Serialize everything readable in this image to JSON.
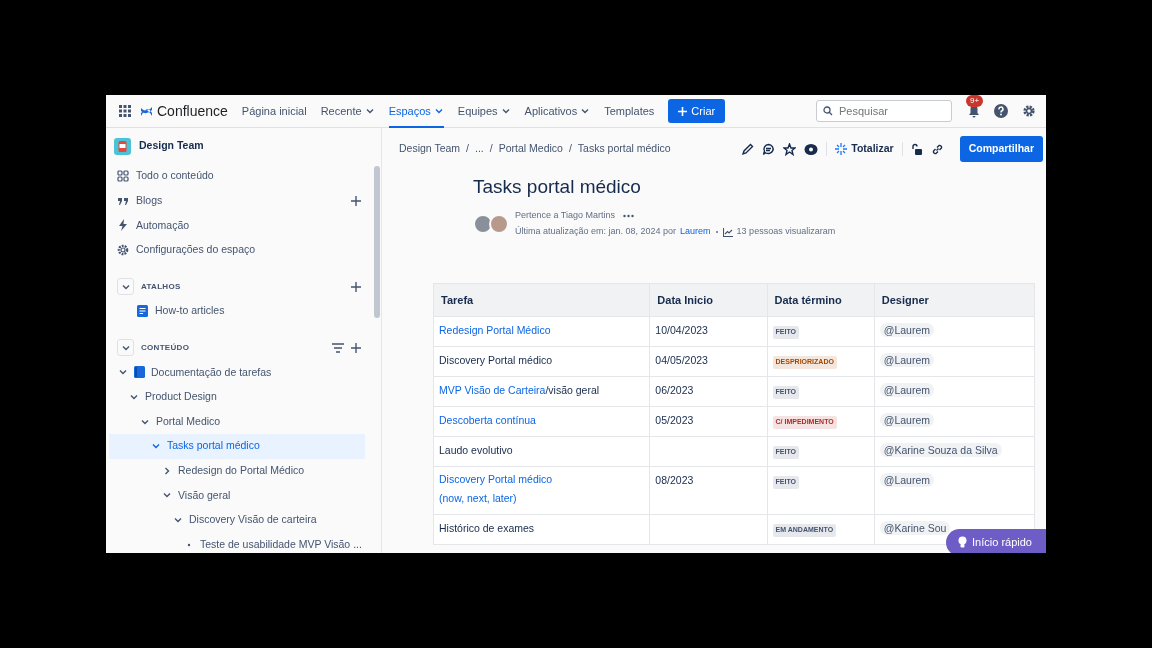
{
  "topnav": {
    "app_name": "Confluence",
    "items": [
      {
        "label": "Página inicial",
        "dropdown": false,
        "selected": false
      },
      {
        "label": "Recente",
        "dropdown": true,
        "selected": false
      },
      {
        "label": "Espaços",
        "dropdown": true,
        "selected": true
      },
      {
        "label": "Equipes",
        "dropdown": true,
        "selected": false
      },
      {
        "label": "Aplicativos",
        "dropdown": true,
        "selected": false
      },
      {
        "label": "Templates",
        "dropdown": false,
        "selected": false
      }
    ],
    "create_button": "Criar",
    "search": {
      "placeholder": "Pesquisar"
    },
    "notification_badge": "9+"
  },
  "sidebar": {
    "space_name": "Design Team",
    "links": [
      {
        "kind": "grid",
        "label": "Todo o conteúdo",
        "addable": false
      },
      {
        "kind": "quote",
        "label": "Blogs",
        "addable": true
      },
      {
        "kind": "bolt",
        "label": "Automação",
        "addable": false
      },
      {
        "kind": "gear",
        "label": "Configurações do espaço",
        "addable": false
      }
    ],
    "shortcuts": {
      "heading": "ATALHOS",
      "items": [
        "How-to articles"
      ]
    },
    "content": {
      "heading": "CONTEÚDO",
      "tree": [
        {
          "label": "Documentação de tarefas",
          "expanded": true,
          "selected": false,
          "children": [
            {
              "label": "Product Design",
              "expanded": true,
              "selected": false,
              "children": [
                {
                  "label": "Portal Medico",
                  "expanded": true,
                  "selected": false,
                  "children": [
                    {
                      "label": "Tasks portal médico",
                      "expanded": true,
                      "selected": true,
                      "children": [
                        {
                          "label": "Redesign do Portal Médico",
                          "expanded": false,
                          "expandable": true,
                          "selected": false
                        },
                        {
                          "label": "Visão geral",
                          "expanded": true,
                          "selected": false,
                          "children": [
                            {
                              "label": "Discovery Visão de carteira",
                              "expanded": true,
                              "selected": false,
                              "children": [
                                {
                                  "label": "Teste de usabilidade MVP Visão ...",
                                  "expanded": false,
                                  "expandable": false,
                                  "selected": false
                                }
                              ]
                            }
                          ]
                        }
                      ]
                    }
                  ]
                }
              ]
            }
          ]
        }
      ]
    }
  },
  "page": {
    "breadcrumbs": [
      {
        "label": "Design Team",
        "separator": "/"
      },
      {
        "label": "...",
        "separator": "/"
      },
      {
        "label": "Portal Medico",
        "separator": "/"
      },
      {
        "label": "Tasks portal médico"
      }
    ],
    "toolbar": {
      "summarize": "Totalizar",
      "share": "Compartilhar"
    },
    "title": "Tasks portal médico",
    "owner_line": "Pertence a Tiago Martins",
    "updated": "Última atualização em: jan. 08, 2024 por",
    "updated_by": "Laurem",
    "views": "13 pessoas visualizaram",
    "table": {
      "columns": [
        "Tarefa",
        "Data Inicio",
        "Data término",
        "Designer"
      ],
      "rows": [
        {
          "task": [
            {
              "text": "Redesign Portal Médico",
              "link": true
            }
          ],
          "start": "10/04/2023",
          "status": {
            "text": "FEITO",
            "color": "#44546f"
          },
          "designer": "@Laurem"
        },
        {
          "task": [
            {
              "text": "Discovery Portal médico",
              "link": false
            }
          ],
          "start": "04/05/2023",
          "status": {
            "text": "DESPRIORIZADO",
            "color": "#a54800"
          },
          "designer": "@Laurem"
        },
        {
          "task": [
            {
              "text": "MVP Visão de Carteira",
              "link": true
            },
            {
              "text": "/visão geral",
              "link": false
            }
          ],
          "start": "06/2023",
          "status": {
            "text": "FEITO",
            "color": "#44546f"
          },
          "designer": "@Laurem"
        },
        {
          "task": [
            {
              "text": "Descoberta contínua",
              "link": true
            }
          ],
          "start": "05/2023",
          "status": {
            "text": "C/ IMPEDIMENTO",
            "color": "#ae2e24"
          },
          "designer": "@Laurem"
        },
        {
          "task": [
            {
              "text": "Laudo evolutivo",
              "link": false
            }
          ],
          "status": {
            "text": "FEITO",
            "color": "#44546f"
          },
          "designer": "@Karine Souza da Silva"
        },
        {
          "task": [
            {
              "text": "Discovery Portal médico (now, next, later)",
              "link": true
            }
          ],
          "start": "08/2023",
          "status": {
            "text": "FEITO",
            "color": "#44546f"
          },
          "designer": "@Laurem"
        },
        {
          "task": [
            {
              "text": "Histórico de exames",
              "link": false
            }
          ],
          "status": {
            "text": "EM ANDAMENTO",
            "color": "#44546f"
          },
          "designer": "@Karine Sou"
        }
      ]
    }
  },
  "quick_start": "Início rápido"
}
